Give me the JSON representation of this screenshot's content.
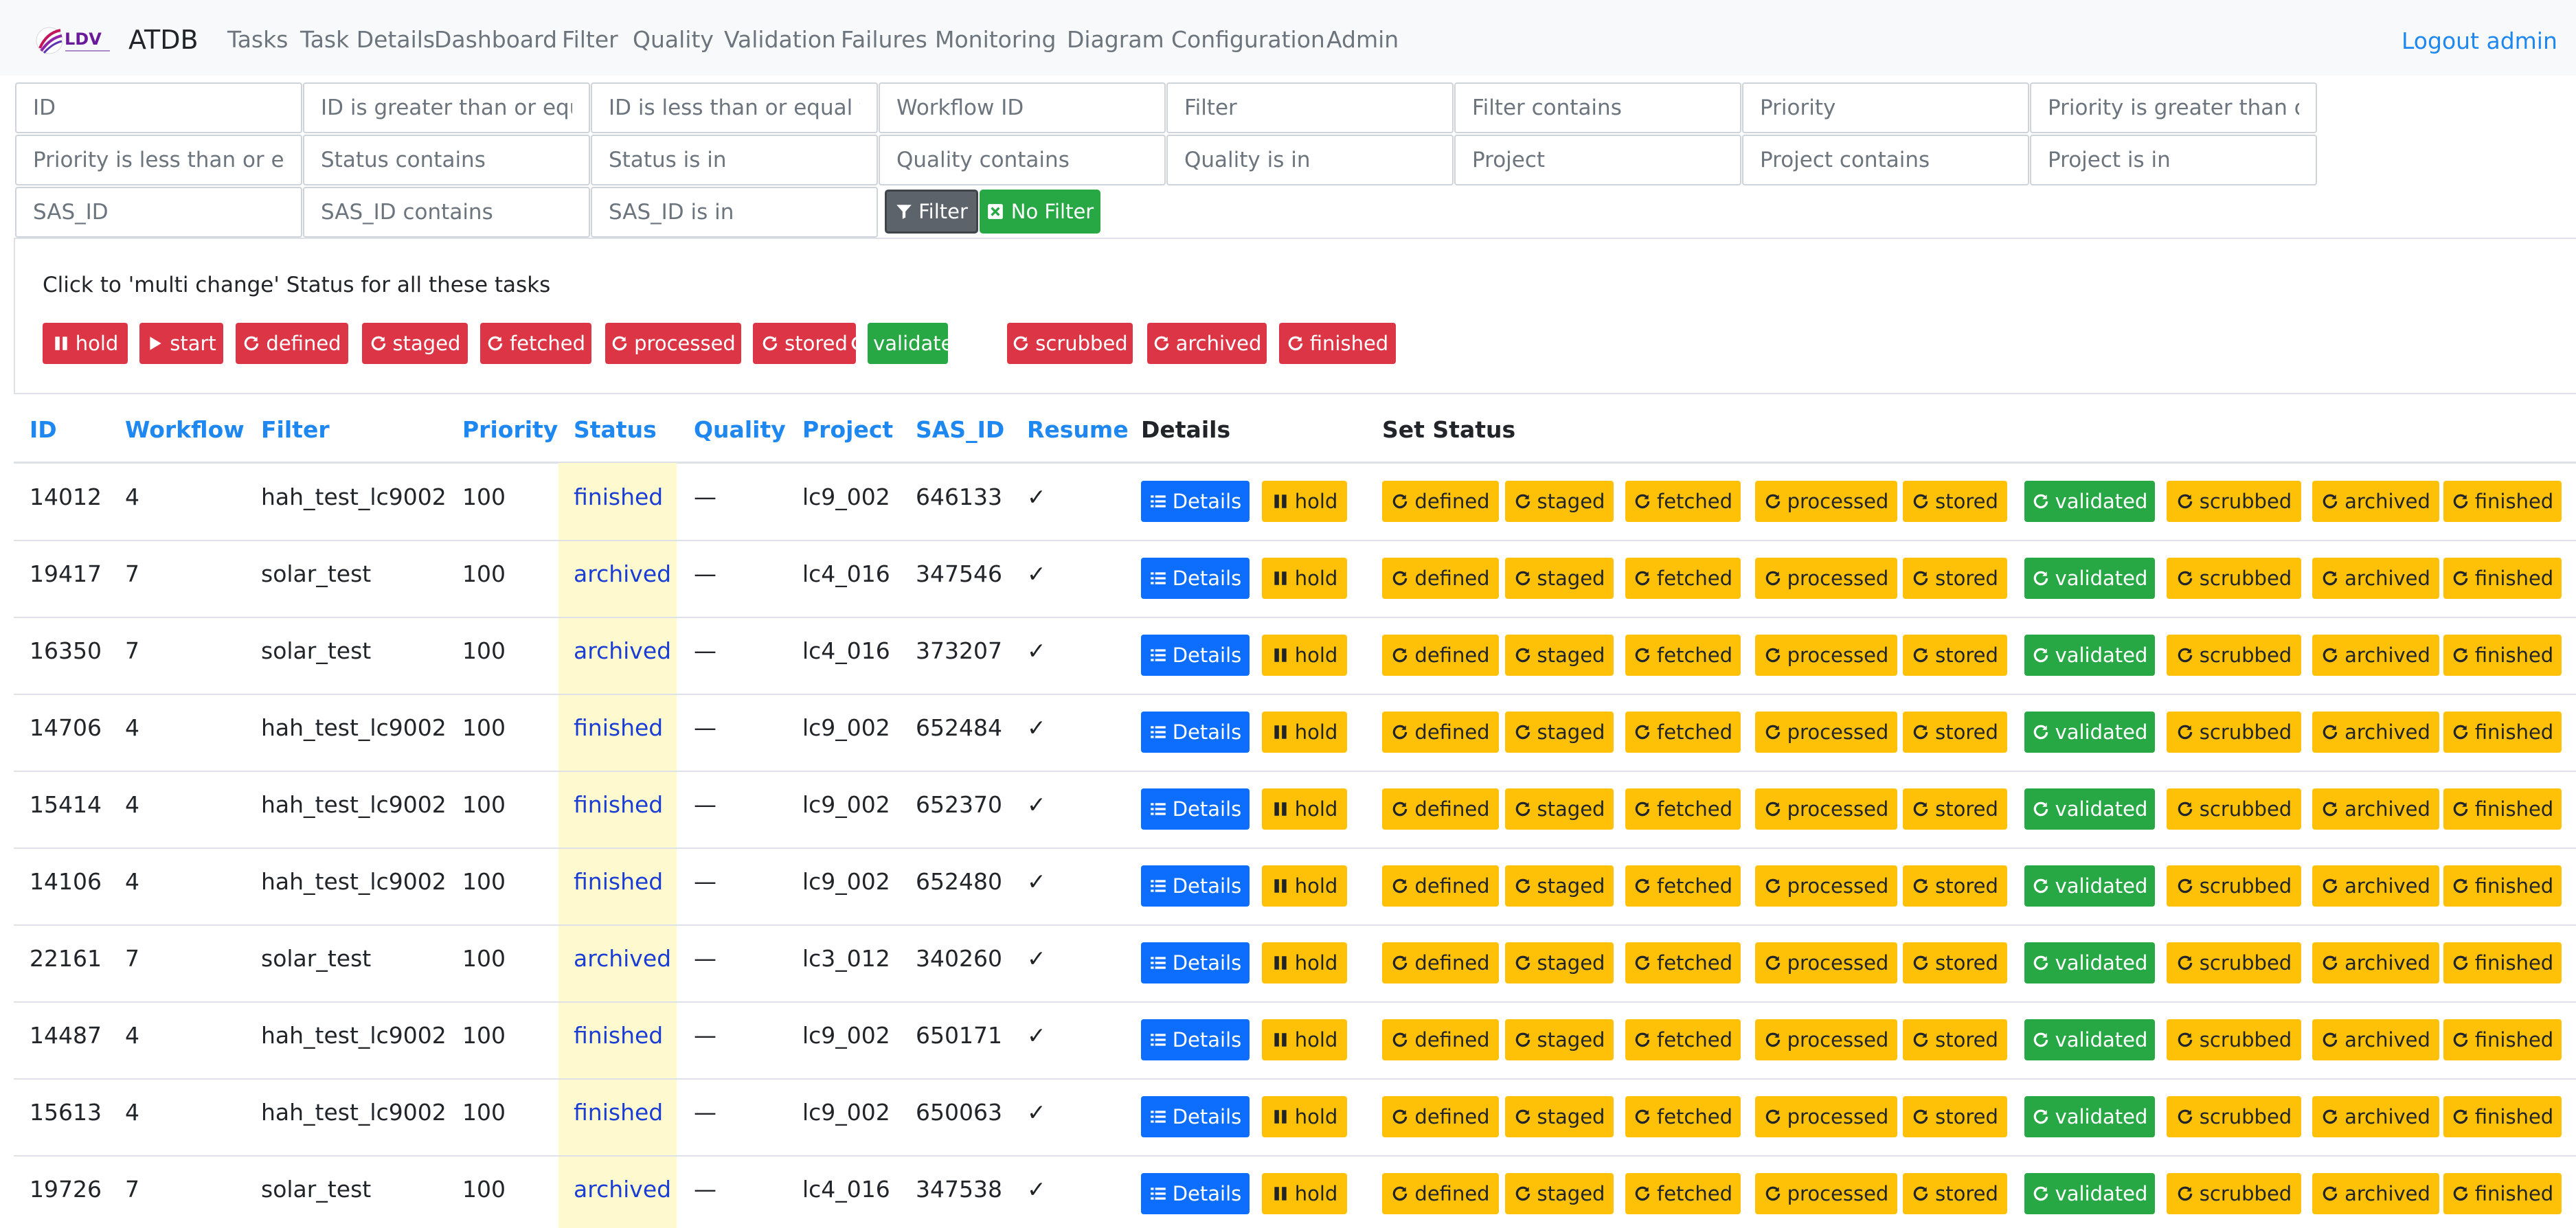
{
  "app": {
    "brand": "ATDB",
    "logo_text": "LDV",
    "logout": "Logout admin"
  },
  "nav": [
    "Tasks",
    "Task Details",
    "Dashboard",
    "Filter",
    "Quality",
    "Validation",
    "Failures",
    "Monitoring",
    "Diagram",
    "Configuration",
    "Admin"
  ],
  "filters": {
    "placeholders": [
      "ID",
      "ID is greater than or equal to",
      "ID is less than or equal to",
      "Workflow ID",
      "Filter",
      "Filter contains",
      "Priority",
      "Priority is greater than or equal to",
      "Priority is less than or equal to",
      "Status contains",
      "Status is in",
      "Quality contains",
      "Quality is in",
      "Project",
      "Project contains",
      "Project is in",
      "SAS_ID",
      "SAS_ID contains",
      "SAS_ID is in"
    ],
    "filter_button": "Filter",
    "nofilter_button": "No Filter"
  },
  "multi_change": {
    "text": "Click to 'multi change' Status for all these tasks",
    "buttons": [
      "hold",
      "start",
      "defined",
      "staged",
      "fetched",
      "processed",
      "stored",
      "validated",
      "scrubbed",
      "archived",
      "finished"
    ]
  },
  "table": {
    "headers": [
      "ID",
      "Workflow",
      "Filter",
      "Priority",
      "Status",
      "Quality",
      "Project",
      "SAS_ID",
      "Resume",
      "Details",
      "Set Status"
    ],
    "details_label": "Details",
    "hold_label": "hold",
    "set_status": [
      "defined",
      "staged",
      "fetched",
      "processed",
      "stored",
      "validated",
      "scrubbed",
      "archived",
      "finished"
    ],
    "rows": [
      [
        "14012",
        "4",
        "hah_test_lc9002",
        "100",
        "finished",
        "—",
        "lc9_002",
        "646133",
        "✓"
      ],
      [
        "19417",
        "7",
        "solar_test",
        "100",
        "archived",
        "—",
        "lc4_016",
        "347546",
        "✓"
      ],
      [
        "16350",
        "7",
        "solar_test",
        "100",
        "archived",
        "—",
        "lc4_016",
        "373207",
        "✓"
      ],
      [
        "14706",
        "4",
        "hah_test_lc9002",
        "100",
        "finished",
        "—",
        "lc9_002",
        "652484",
        "✓"
      ],
      [
        "15414",
        "4",
        "hah_test_lc9002",
        "100",
        "finished",
        "—",
        "lc9_002",
        "652370",
        "✓"
      ],
      [
        "14106",
        "4",
        "hah_test_lc9002",
        "100",
        "finished",
        "—",
        "lc9_002",
        "652480",
        "✓"
      ],
      [
        "22161",
        "7",
        "solar_test",
        "100",
        "archived",
        "—",
        "lc3_012",
        "340260",
        "✓"
      ],
      [
        "14487",
        "4",
        "hah_test_lc9002",
        "100",
        "finished",
        "—",
        "lc9_002",
        "650171",
        "✓"
      ],
      [
        "15613",
        "4",
        "hah_test_lc9002",
        "100",
        "finished",
        "—",
        "lc9_002",
        "650063",
        "✓"
      ],
      [
        "19726",
        "7",
        "solar_test",
        "100",
        "archived",
        "—",
        "lc4_016",
        "347538",
        "✓"
      ]
    ]
  },
  "colors": {
    "link": "#1e88f0",
    "danger": "#dc3545",
    "success": "#28a745",
    "warning": "#ffc107",
    "primary": "#0d6efd",
    "status_highlight": "#fff9d0"
  }
}
